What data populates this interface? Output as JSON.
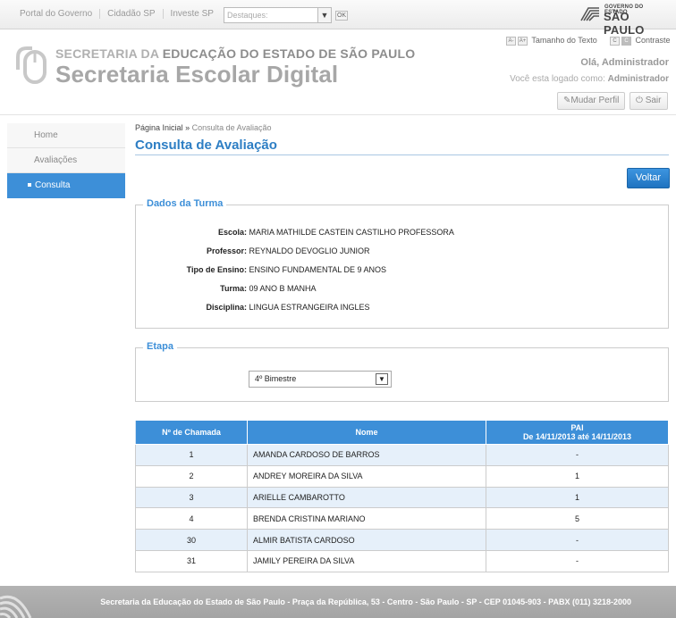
{
  "topbar": {
    "links": [
      "Portal do Governo",
      "Cidadão SP",
      "Investe SP"
    ],
    "destaques_placeholder": "Destaques:",
    "ok_label": "OK",
    "gov_small": "GOVERNO DO ESTADO",
    "gov_big": "SÃO PAULO"
  },
  "header": {
    "line1_light": "SECRETARIA DA ",
    "line1_bold": "EDUCAÇÃO DO ESTADO DE SÃO PAULO",
    "line2": "Secretaria Escolar Digital",
    "font_minus": "A-",
    "font_plus": "A+",
    "font_label": "Tamanho do Texto",
    "contrast_a": "C",
    "contrast_b": "C",
    "contrast_label": "Contraste",
    "hello": "Olá, Administrador",
    "logged_prefix": "Você esta logado como: ",
    "logged_user": "Administrador",
    "change_profile": "Mudar Perfil",
    "logout": "Sair"
  },
  "sidebar": {
    "items": [
      "Home",
      "Avaliações",
      "Consulta"
    ]
  },
  "breadcrumb": {
    "home": "Página Inicial",
    "sep": "»",
    "current": "Consulta de Avaliação"
  },
  "page": {
    "title": "Consulta de Avaliação",
    "back_button": "Voltar"
  },
  "turma": {
    "legend": "Dados da Turma",
    "fields": [
      {
        "label": "Escola:",
        "value": "MARIA MATHILDE CASTEIN CASTILHO PROFESSORA"
      },
      {
        "label": "Professor:",
        "value": "REYNALDO DEVOGLIO JUNIOR"
      },
      {
        "label": "Tipo de Ensino:",
        "value": "ENSINO FUNDAMENTAL DE 9 ANOS"
      },
      {
        "label": "Turma:",
        "value": "09 ANO B MANHA"
      },
      {
        "label": "Disciplina:",
        "value": "LINGUA ESTRANGEIRA INGLES"
      }
    ]
  },
  "etapa": {
    "legend": "Etapa",
    "selected": "4º Bimestre"
  },
  "table": {
    "headers": [
      "Nº de Chamada",
      "Nome",
      "PAI",
      "De 14/11/2013 até 14/11/2013"
    ],
    "rows": [
      [
        "1",
        "AMANDA CARDOSO DE BARROS",
        "-"
      ],
      [
        "2",
        "ANDREY MOREIRA DA SILVA",
        "1"
      ],
      [
        "3",
        "ARIELLE CAMBAROTTO",
        "1"
      ],
      [
        "4",
        "BRENDA CRISTINA MARIANO",
        "5"
      ],
      [
        "30",
        "ALMIR BATISTA CARDOSO",
        "-"
      ],
      [
        "31",
        "JAMILY PEREIRA DA SILVA",
        "-"
      ]
    ]
  },
  "footer": {
    "text": "Secretaria da Educação do Estado de São Paulo - Praça da República, 53 - Centro - São Paulo - SP - CEP 01045-903 - PABX (011) 3218-2000"
  }
}
